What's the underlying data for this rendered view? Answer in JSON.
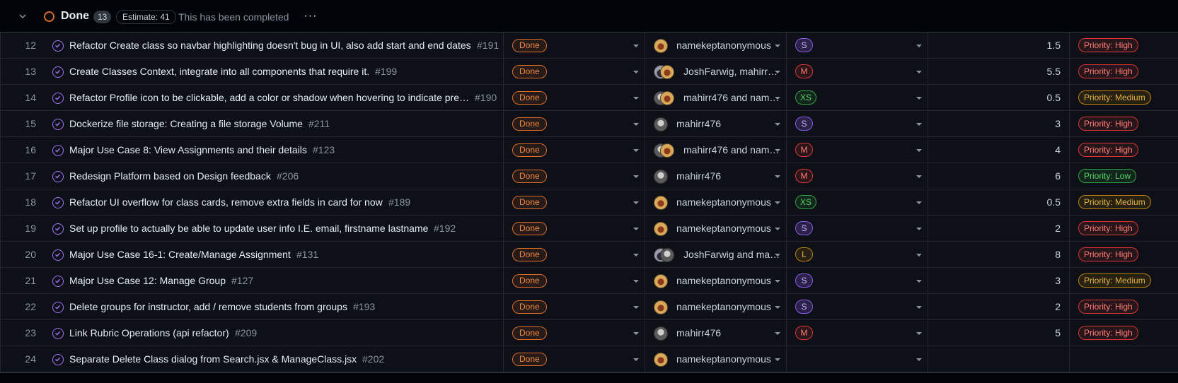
{
  "group": {
    "title": "Done",
    "count": "13",
    "estimate": "Estimate: 41",
    "description": "This has been completed",
    "more": "···"
  },
  "rows": [
    {
      "num": "12",
      "title": "Refactor Create class so navbar highlighting doesn't bug in UI, also add start and end dates",
      "ref": "#191",
      "status": "Done",
      "assignee": "namekeptanonymous",
      "avatars": [
        "yellow"
      ],
      "size": "S",
      "estimate": "1.5",
      "priority": "Priority: High",
      "priority_level": "High"
    },
    {
      "num": "13",
      "title": "Create Classes Context, integrate into all components that require it.",
      "ref": "#199",
      "status": "Done",
      "assignee": "JoshFarwig, mahirr…",
      "avatars": [
        "dark",
        "yellow"
      ],
      "size": "M",
      "estimate": "5.5",
      "priority": "Priority: High",
      "priority_level": "High"
    },
    {
      "num": "14",
      "title": "Refactor Profile icon to be clickable, add a color or shadow when hovering to indicate pre…",
      "ref": "#190",
      "status": "Done",
      "assignee": "mahirr476 and nam…",
      "avatars": [
        "gray",
        "yellow"
      ],
      "size": "XS",
      "estimate": "0.5",
      "priority": "Priority: Medium",
      "priority_level": "Medium"
    },
    {
      "num": "15",
      "title": "Dockerize file storage: Creating a file storage Volume",
      "ref": "#211",
      "status": "Done",
      "assignee": "mahirr476",
      "avatars": [
        "gray"
      ],
      "size": "S",
      "estimate": "3",
      "priority": "Priority: High",
      "priority_level": "High"
    },
    {
      "num": "16",
      "title": "Major Use Case 8: View Assignments and their details",
      "ref": "#123",
      "status": "Done",
      "assignee": "mahirr476 and nam…",
      "avatars": [
        "gray",
        "yellow"
      ],
      "size": "M",
      "estimate": "4",
      "priority": "Priority: High",
      "priority_level": "High"
    },
    {
      "num": "17",
      "title": "Redesign Platform based on Design feedback",
      "ref": "#206",
      "status": "Done",
      "assignee": "mahirr476",
      "avatars": [
        "gray"
      ],
      "size": "M",
      "estimate": "6",
      "priority": "Priority: Low",
      "priority_level": "Low"
    },
    {
      "num": "18",
      "title": "Refactor UI overflow for class cards, remove extra fields in card for now",
      "ref": "#189",
      "status": "Done",
      "assignee": "namekeptanonymous",
      "avatars": [
        "yellow"
      ],
      "size": "XS",
      "estimate": "0.5",
      "priority": "Priority: Medium",
      "priority_level": "Medium"
    },
    {
      "num": "19",
      "title": "Set up profile to actually be able to update user info I.E. email, firstname lastname",
      "ref": "#192",
      "status": "Done",
      "assignee": "namekeptanonymous",
      "avatars": [
        "yellow"
      ],
      "size": "S",
      "estimate": "2",
      "priority": "Priority: High",
      "priority_level": "High"
    },
    {
      "num": "20",
      "title": "Major Use Case 16-1: Create/Manage Assignment",
      "ref": "#131",
      "status": "Done",
      "assignee": "JoshFarwig and ma…",
      "avatars": [
        "dark",
        "gray"
      ],
      "size": "L",
      "estimate": "8",
      "priority": "Priority: High",
      "priority_level": "High"
    },
    {
      "num": "21",
      "title": "Major Use Case 12: Manage Group",
      "ref": "#127",
      "status": "Done",
      "assignee": "namekeptanonymous",
      "avatars": [
        "yellow"
      ],
      "size": "S",
      "estimate": "3",
      "priority": "Priority: Medium",
      "priority_level": "Medium"
    },
    {
      "num": "22",
      "title": "Delete groups for instructor, add / remove students from groups",
      "ref": "#193",
      "status": "Done",
      "assignee": "namekeptanonymous",
      "avatars": [
        "yellow"
      ],
      "size": "S",
      "estimate": "2",
      "priority": "Priority: High",
      "priority_level": "High"
    },
    {
      "num": "23",
      "title": "Link Rubric Operations (api refactor)",
      "ref": "#209",
      "status": "Done",
      "assignee": "mahirr476",
      "avatars": [
        "gray"
      ],
      "size": "M",
      "estimate": "5",
      "priority": "Priority: High",
      "priority_level": "High"
    },
    {
      "num": "24",
      "title": "Separate Delete Class dialog from Search.jsx & ManageClass.jsx",
      "ref": "#202",
      "status": "Done",
      "assignee": "namekeptanonymous",
      "avatars": [
        "yellow"
      ],
      "size": "",
      "estimate": "",
      "priority": "",
      "priority_level": ""
    }
  ]
}
